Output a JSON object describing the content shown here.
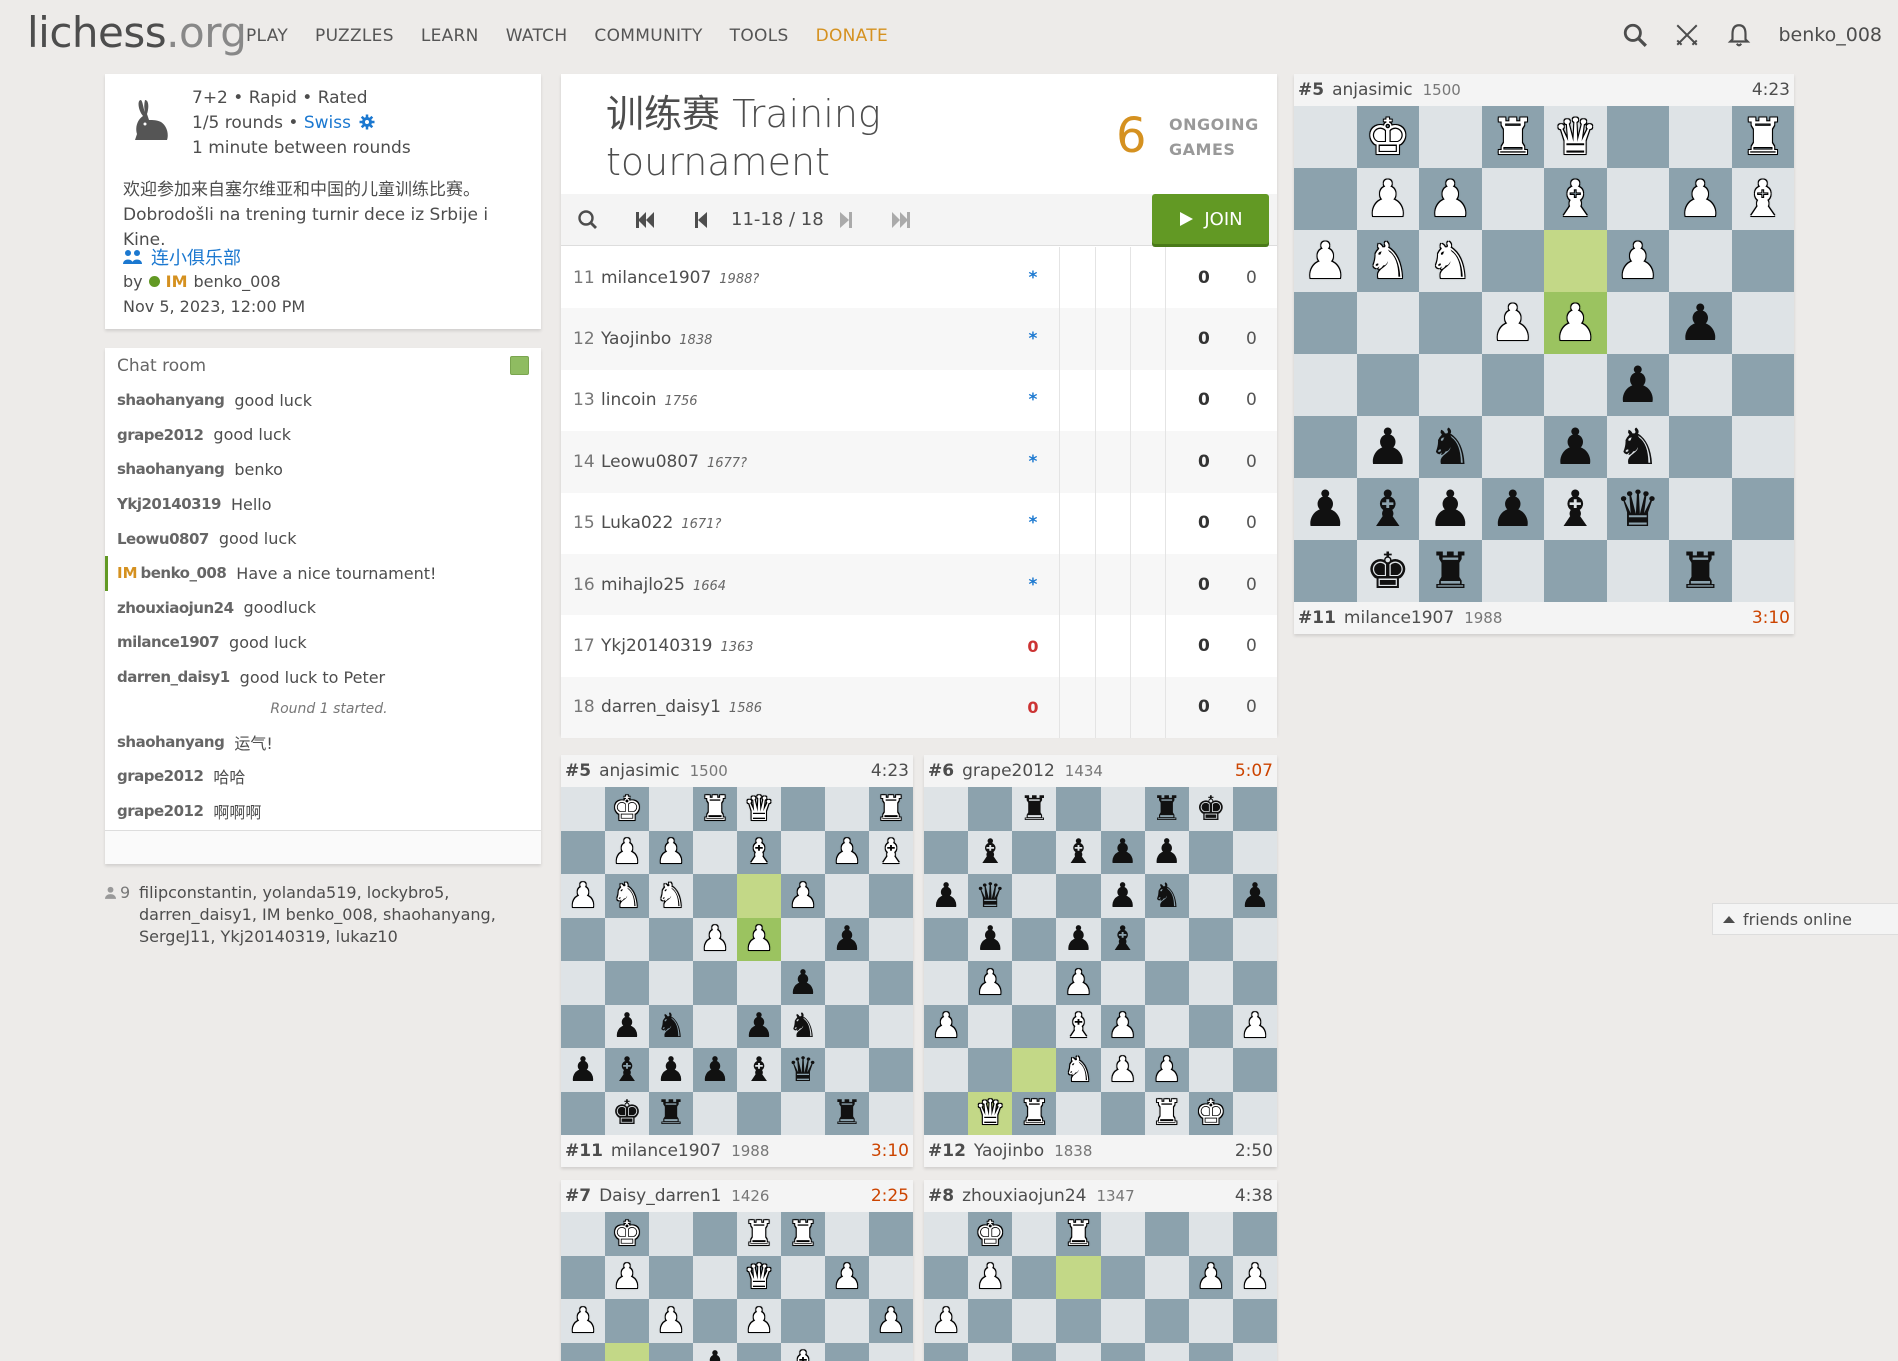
{
  "header": {
    "logo_main": "lichess",
    "logo_tld": ".org",
    "nav": [
      "PLAY",
      "PUZZLES",
      "LEARN",
      "WATCH",
      "COMMUNITY",
      "TOOLS",
      "DONATE"
    ],
    "username": "benko_008"
  },
  "info": {
    "format": "7+2 • Rapid • Rated",
    "rounds": "1/5 rounds • ",
    "swiss": "Swiss",
    "between": "1 minute between rounds",
    "desc_zh": "欢迎参加来自塞尔维亚和中国的儿童训练比赛。",
    "desc_sr": "Dobrodošli na trening turnir dece iz Srbije i Kine.",
    "team": "连小俱乐部",
    "by": "by",
    "by_title": "IM",
    "by_user": "benko_008",
    "created": "Nov 5, 2023, 12:00 PM"
  },
  "chat": {
    "title": "Chat room",
    "lines": [
      {
        "user": "shaohanyang",
        "text": "good luck"
      },
      {
        "user": "grape2012",
        "text": "good luck"
      },
      {
        "user": "shaohanyang",
        "text": "benko"
      },
      {
        "user": "Ykj20140319",
        "text": "Hello"
      },
      {
        "user": "Leowu0807",
        "text": "good luck"
      },
      {
        "user_title": "IM",
        "user": "benko_008",
        "text": "Have a nice tournament!"
      },
      {
        "user": "zhouxiaojun24",
        "text": "goodluck"
      },
      {
        "user": "milance1907",
        "text": "good luck"
      },
      {
        "user": "darren_daisy1",
        "text": "good luck to Peter"
      },
      {
        "system": "Round 1 started."
      },
      {
        "user": "shaohanyang",
        "text": "运气!"
      },
      {
        "user": "grape2012",
        "text": "哈哈"
      },
      {
        "user": "grape2012",
        "text": "啊啊啊"
      }
    ]
  },
  "spectators": {
    "count": "9",
    "list": "filipconstantin, yolanda519, lockybro5, darren_daisy1, IM benko_008, shaohanyang, SergeJ11, Ykj20140319, lukaz10"
  },
  "tournament": {
    "title": "训练赛 Training tournament",
    "ongoing_count": "6",
    "ongoing_label_1": "ONGOING",
    "ongoing_label_2": "GAMES",
    "pager": "11-18 / 18",
    "join": "JOIN",
    "standings": [
      {
        "rank": "11",
        "name": "milance1907",
        "rating": "1988?",
        "r1": "*",
        "pts": "0",
        "tb": "0"
      },
      {
        "rank": "12",
        "name": "Yaojinbo",
        "rating": "1838",
        "r1": "*",
        "pts": "0",
        "tb": "0"
      },
      {
        "rank": "13",
        "name": "lincoin",
        "rating": "1756",
        "r1": "*",
        "pts": "0",
        "tb": "0"
      },
      {
        "rank": "14",
        "name": "Leowu0807",
        "rating": "1677?",
        "r1": "*",
        "pts": "0",
        "tb": "0"
      },
      {
        "rank": "15",
        "name": "Luka022",
        "rating": "1671?",
        "r1": "*",
        "pts": "0",
        "tb": "0"
      },
      {
        "rank": "16",
        "name": "mihajlo25",
        "rating": "1664",
        "r1": "*",
        "pts": "0",
        "tb": "0"
      },
      {
        "rank": "17",
        "name": "Ykj20140319",
        "rating": "1363",
        "r1": "0",
        "pts": "0",
        "tb": "0"
      },
      {
        "rank": "18",
        "name": "darren_daisy1",
        "rating": "1586",
        "r1": "0",
        "pts": "0",
        "tb": "0"
      }
    ]
  },
  "featured": {
    "top": {
      "rank": "#5",
      "name": "anjasimic",
      "rating": "1500",
      "clock": "4:23"
    },
    "bottom": {
      "rank": "#11",
      "name": "milance1907",
      "rating": "1988",
      "clock": "3:10"
    }
  },
  "games": [
    {
      "top": {
        "rank": "#5",
        "name": "anjasimic",
        "rating": "1500",
        "clock": "4:23"
      },
      "bottom": {
        "rank": "#11",
        "name": "milance1907",
        "rating": "1988",
        "clock": "3:10"
      }
    },
    {
      "top": {
        "rank": "#6",
        "name": "grape2012",
        "rating": "1434",
        "clock": "5:07"
      },
      "bottom": {
        "rank": "#12",
        "name": "Yaojinbo",
        "rating": "1838",
        "clock": "2:50"
      }
    },
    {
      "top": {
        "rank": "#7",
        "name": "Daisy_darren1",
        "rating": "1426",
        "clock": "2:25"
      },
      "bottom": {
        "rank": "",
        "name": "",
        "rating": "",
        "clock": ""
      }
    },
    {
      "top": {
        "rank": "#8",
        "name": "zhouxiaojun24",
        "rating": "1347",
        "clock": "4:38"
      },
      "bottom": {
        "rank": "",
        "name": "",
        "rating": "",
        "clock": ""
      }
    }
  ],
  "friends": "friends online",
  "boards": {
    "b1": [
      "-K-RQ--R",
      "-PP-B-PB",
      "PNN-.P--",
      "---PP-p-",
      "-----p--",
      "-pn-pn--",
      "pbppbq--",
      "-kr---r-"
    ],
    "b2": [
      "--r--rk-",
      "-b-bpp--",
      "pq--pn-p",
      "-p-pb---",
      "-P-P----",
      "P--BP--P",
      "--.NPP--",
      "-QR--RK-"
    ],
    "b3": [
      "-K--RR--",
      "-P--Q-P-",
      "P-P-P--P",
      "-.-p-B--"
    ],
    "b4": [
      "-K-R----",
      "-P-.--PP",
      "P-------",
      "--------"
    ]
  }
}
